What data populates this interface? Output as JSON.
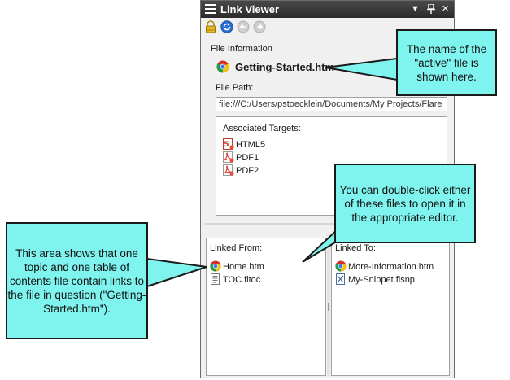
{
  "panel": {
    "title": "Link Viewer",
    "titlebar_buttons": {
      "dropdown": "▼",
      "pin": "⊓",
      "close": "✕"
    },
    "toolbar_icons": [
      "lock-icon",
      "sync-icon",
      "back-icon",
      "forward-icon"
    ],
    "file_information_label": "File Information",
    "active_file": "Getting-Started.htm",
    "file_path_label": "File Path:",
    "file_path_value": "file:///C:/Users/pstoecklein/Documents/My Projects/Flare",
    "associated_targets_label": "Associated Targets:",
    "targets": [
      {
        "name": "HTML5",
        "icon": "html5-target-icon"
      },
      {
        "name": "PDF1",
        "icon": "pdf-target-icon"
      },
      {
        "name": "PDF2",
        "icon": "pdf-target-icon"
      }
    ],
    "linked_from_label": "Linked From:",
    "linked_from": [
      {
        "name": "Home.htm",
        "icon": "browser-topic-icon"
      },
      {
        "name": "TOC.fltoc",
        "icon": "toc-file-icon"
      }
    ],
    "linked_to_label": "Linked To:",
    "linked_to": [
      {
        "name": "More-Information.htm",
        "icon": "browser-topic-icon"
      },
      {
        "name": "My-Snippet.flsnp",
        "icon": "snippet-file-icon"
      }
    ]
  },
  "callouts": {
    "active_file": "The name of the \"active\" file is shown here.",
    "double_click": "You can double-click either of these files to open it in the appropriate editor.",
    "linked_from": "This area shows that one topic and one table of contents file contain links to the file in question (\"Getting-Started.htm\")."
  },
  "colors": {
    "callout_fill": "#7ff3ee",
    "titlebar": "#333333",
    "panel_bg": "#f0f0f0"
  }
}
